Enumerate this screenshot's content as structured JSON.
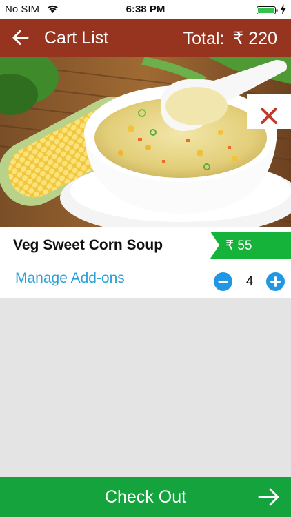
{
  "status_bar": {
    "carrier": "No SIM",
    "time": "6:38 PM",
    "icons": [
      "wifi-icon",
      "battery-icon",
      "charging-bolt-icon"
    ]
  },
  "header": {
    "title": "Cart List",
    "total_label": "Total:",
    "total_value": "₹ 220",
    "back_icon": "arrow-left-icon",
    "background_color": "#96341f"
  },
  "cart": {
    "items": [
      {
        "image_alt": "Bowl of sweet corn soup with a spoon beside a corn cob",
        "remove_icon": "close-x-icon",
        "name": "Veg Sweet Corn Soup",
        "price": "₹ 55",
        "addons_label": "Manage Add-ons",
        "quantity": "4",
        "decrement_icon": "minus-icon",
        "increment_icon": "plus-icon"
      }
    ]
  },
  "footer": {
    "checkout_label": "Check Out",
    "arrow_icon": "arrow-right-icon",
    "background_color": "#14a33c"
  },
  "colors": {
    "accent_red": "#c0392b",
    "price_green": "#16b33a",
    "link_blue": "#2ea0d8",
    "stepper_blue": "#2196e3"
  }
}
